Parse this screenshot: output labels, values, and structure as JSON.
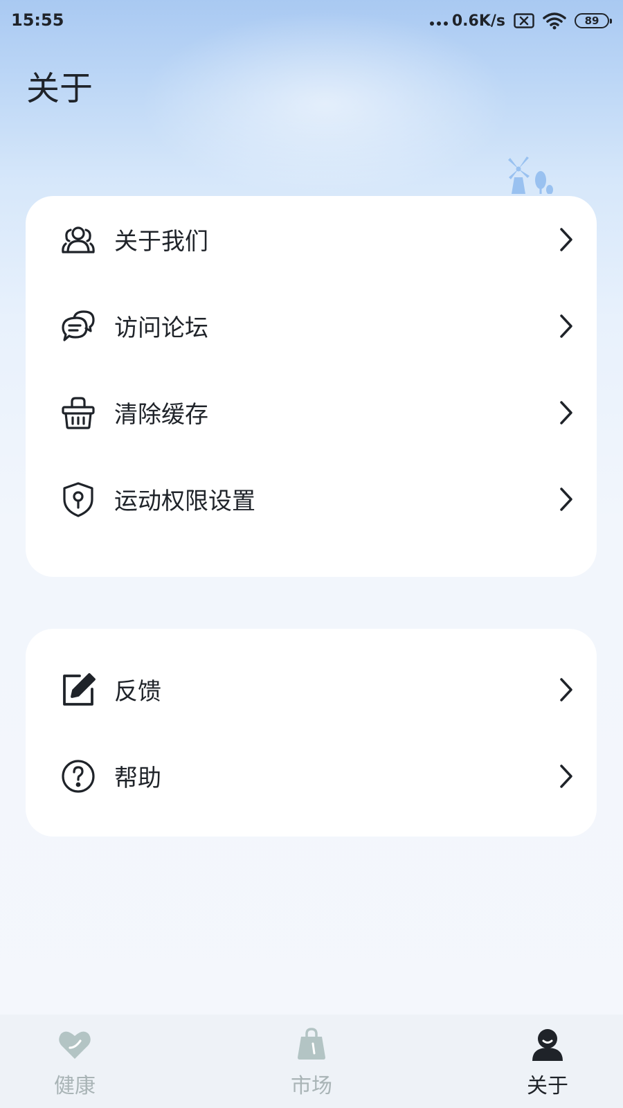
{
  "status_bar": {
    "time": "15:55",
    "net_speed": "0.6K/s",
    "battery": "89",
    "icons": [
      "signal-dots-icon",
      "no-sim-icon",
      "wifi-icon",
      "battery-icon"
    ]
  },
  "header": {
    "title": "关于",
    "decoration_icon": "windmill-icon"
  },
  "menu_group_1": [
    {
      "label": "关于我们",
      "icon": "users-icon"
    },
    {
      "label": "访问论坛",
      "icon": "forum-chat-icon"
    },
    {
      "label": "清除缓存",
      "icon": "basket-icon"
    },
    {
      "label": "运动权限设置",
      "icon": "shield-key-icon"
    }
  ],
  "menu_group_2": [
    {
      "label": "反馈",
      "icon": "edit-icon"
    },
    {
      "label": "帮助",
      "icon": "help-circle-icon"
    }
  ],
  "chevron_icon": "chevron-right-icon",
  "tab_bar": {
    "tabs": [
      {
        "label": "健康",
        "icon": "heart-icon",
        "active": false
      },
      {
        "label": "市场",
        "icon": "shopping-bag-icon",
        "active": false
      },
      {
        "label": "关于",
        "icon": "person-icon",
        "active": true
      }
    ]
  },
  "colors": {
    "text": "#1f2329",
    "tab_inactive": "#a9b4b6",
    "card_background": "#ffffff",
    "sky_top": "#a9c9f2",
    "page_background": "#f4f7fc"
  }
}
